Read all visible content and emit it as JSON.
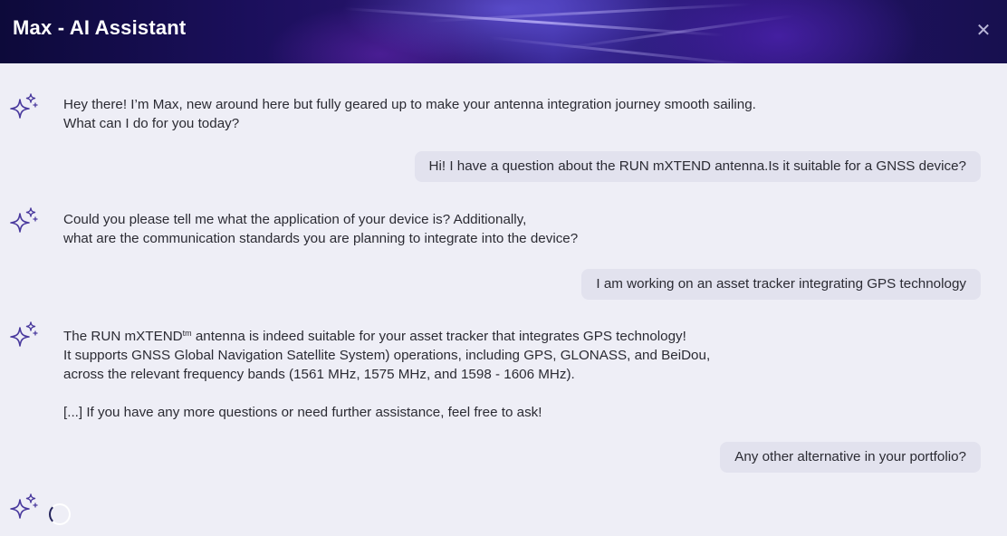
{
  "header": {
    "title": "Max - AI Assistant",
    "close_icon": "close-icon"
  },
  "conversation": [
    {
      "role": "assistant",
      "icon": "sparkles-icon",
      "lines": [
        "Hey there! I’m Max, new around here but fully geared up to make your antenna integration journey smooth sailing.",
        "What can I do for you today?"
      ]
    },
    {
      "role": "user",
      "text": "Hi! I have a question about the RUN mXTEND antenna.Is it suitable for a GNSS device?"
    },
    {
      "role": "assistant",
      "icon": "sparkles-icon",
      "lines": [
        "Could you please tell me what the application of your device is? Additionally,",
        "what are the communication standards you are planning to integrate into the device?"
      ]
    },
    {
      "role": "user",
      "text": "I am working on an asset tracker integrating GPS technology"
    },
    {
      "role": "assistant",
      "icon": "sparkles-icon",
      "line1_before": "The RUN mXTEND",
      "line1_sup": "tm",
      "line1_after": " antenna is indeed suitable for your asset tracker that integrates GPS technology!",
      "lines": [
        "It supports GNSS Global Navigation Satellite System) operations, including GPS, GLONASS, and BeiDou,",
        "across the relevant frequency bands (1561 MHz, 1575 MHz, and 1598 - 1606 MHz)."
      ],
      "closing": "[...] If you have any more questions or need further assistance, feel free to ask!"
    },
    {
      "role": "user",
      "text": "Any other alternative in your portfolio?"
    },
    {
      "role": "assistant",
      "icon": "sparkles-icon",
      "status": "loading"
    }
  ],
  "colors": {
    "background": "#eeeef6",
    "user_bubble": "#e2e2ee",
    "icon_stroke": "#4a3a9e",
    "text": "#2b2b33"
  }
}
